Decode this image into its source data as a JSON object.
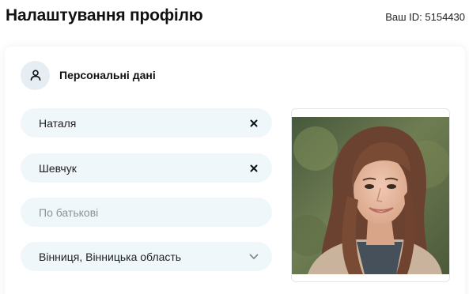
{
  "header": {
    "title": "Налаштування профілю",
    "user_id_label": "Ваш ID: 5154430"
  },
  "personal": {
    "section_title": "Персональні дані",
    "section_icon": "user-icon",
    "first_name": {
      "value": "Наталя",
      "clear_icon": "close-icon"
    },
    "last_name": {
      "value": "Шевчук",
      "clear_icon": "close-icon"
    },
    "patronymic": {
      "value": "",
      "placeholder": "По батькові"
    },
    "city": {
      "value": "Вінниця, Вінницька область",
      "icon": "chevron-down-icon"
    }
  },
  "photo": {
    "icon": "profile-photo"
  },
  "colors": {
    "field_bg": "#f0f7fb",
    "icon_circle_bg": "#e6eef4"
  }
}
